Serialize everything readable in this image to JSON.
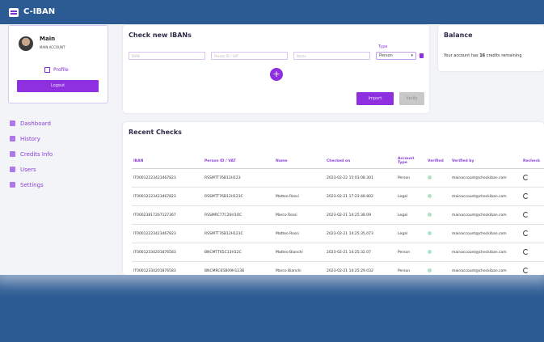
{
  "app": {
    "name": "C-IBAN"
  },
  "user": {
    "name": "Main",
    "role": "MAIN ACCOUNT",
    "profile_label": "Profile",
    "logout_label": "Logout"
  },
  "nav": {
    "items": [
      {
        "label": "Dashboard",
        "icon": "dashboard-icon"
      },
      {
        "label": "History",
        "icon": "history-icon"
      },
      {
        "label": "Credits Info",
        "icon": "credits-icon"
      },
      {
        "label": "Users",
        "icon": "users-icon"
      },
      {
        "label": "Settings",
        "icon": "settings-icon"
      }
    ]
  },
  "check": {
    "title": "Check new IBANs",
    "iban_placeholder": "IBAN",
    "person_placeholder": "Person ID / VAT",
    "name_placeholder": "Name",
    "type_label": "Type",
    "type_value": "Person",
    "import_label": "Import",
    "verify_label": "Verify"
  },
  "balance": {
    "title": "Balance",
    "text_before": "Your account has ",
    "credits": "16",
    "text_after": " credits remaining"
  },
  "recent": {
    "title": "Recent Checks",
    "headers": [
      "IBAN",
      "Person ID / VAT",
      "Name",
      "Checked on",
      "Account Type",
      "Verified",
      "Verified by",
      "Recheck"
    ],
    "rows": [
      [
        "IT00012223423467823",
        "RSSMTT76B12H123",
        "",
        "2023-02-22 15:03:08.301",
        "Person",
        "",
        "mainaccount@checkiban.com",
        ""
      ],
      [
        "IT00012223423467823",
        "RSSMTT76B12H123C",
        "Matteo Rossi",
        "2023-02-21 17:23:48.802",
        "Legal",
        "",
        "mainaccount@checkiban.com",
        ""
      ],
      [
        "IT00023817267127367",
        "RSSMRC77C26H1OC",
        "Marco Rossi",
        "2023-02-21 14:25:38.09",
        "Legal",
        "",
        "mainaccount@checkiban.com",
        ""
      ],
      [
        "IT00012223423467823",
        "RSSMTT76B12H123C",
        "Matteo Rossi",
        "2023-02-21 14:25:35.073",
        "Legal",
        "",
        "mainaccount@checkiban.com",
        ""
      ],
      [
        "IT00012334201876583",
        "BNCMTT65C13H12C",
        "Matteo Bianchi",
        "2023-02-21 14:25:32.07",
        "Person",
        "",
        "mainaccount@checkiban.com",
        ""
      ],
      [
        "IT00012334201876583",
        "BNCMRC65B09H123B",
        "Marco Bianchi",
        "2023-02-21 14:25:29.032",
        "Person",
        "",
        "mainaccount@checkiban.com",
        ""
      ]
    ]
  },
  "colors": {
    "accent": "#8e2fe0",
    "topbar": "#2c5a93",
    "background": "#2c5a93"
  }
}
